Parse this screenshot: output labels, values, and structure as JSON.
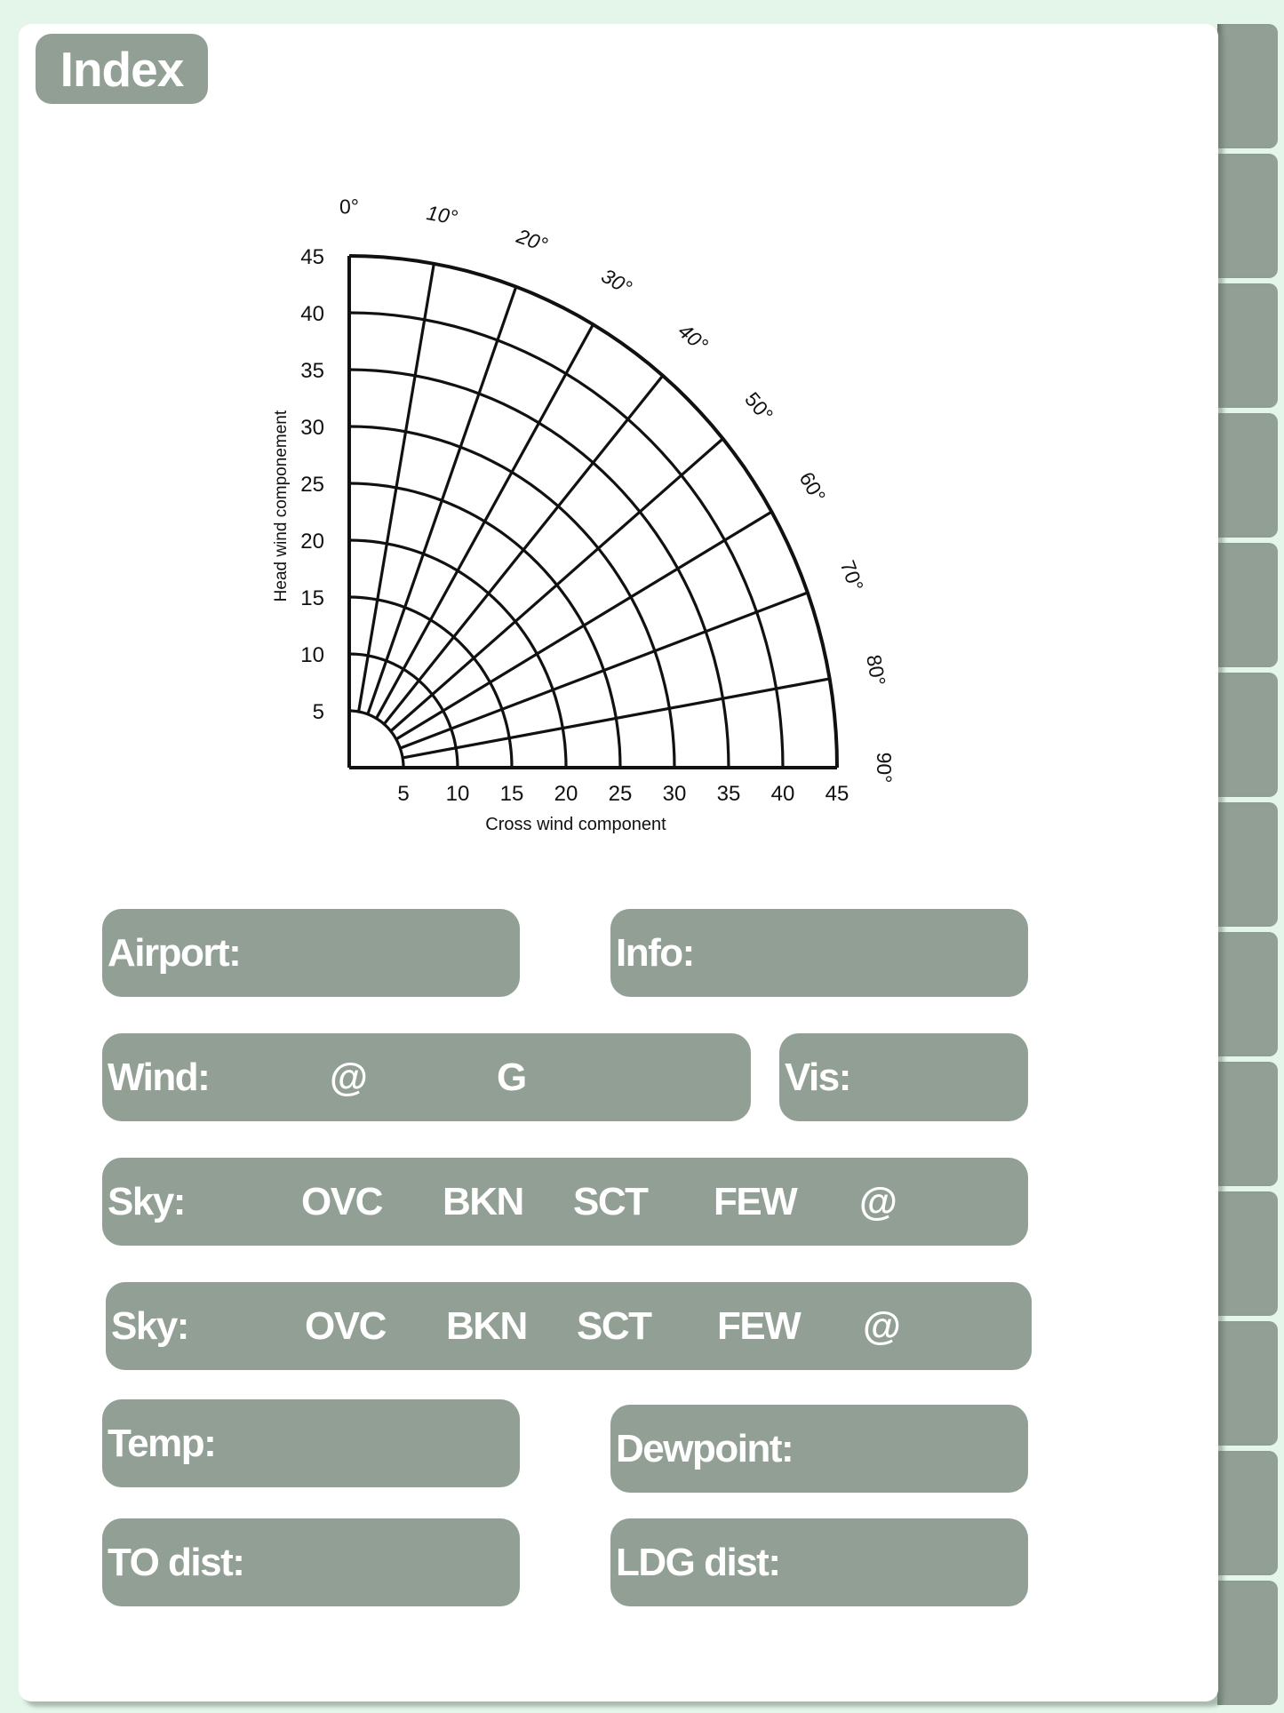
{
  "header": {
    "index_label": "Index"
  },
  "tabs_count": 13,
  "colors": {
    "accent": "#919f94",
    "background": "#e4f5ea",
    "page": "#ffffff",
    "text_on_accent": "#ffffff"
  },
  "chart_data": {
    "type": "polar-grid",
    "title": "",
    "xlabel": "Cross wind component",
    "ylabel": "Head wind componement",
    "x_ticks": [
      "5",
      "10",
      "15",
      "20",
      "25",
      "30",
      "35",
      "40",
      "45"
    ],
    "y_ticks": [
      "5",
      "10",
      "15",
      "20",
      "25",
      "30",
      "35",
      "40",
      "45"
    ],
    "angle_ticks": [
      "0°",
      "10°",
      "20°",
      "30°",
      "40°",
      "50°",
      "60°",
      "70°",
      "80°",
      "90°"
    ],
    "radii": [
      5,
      10,
      15,
      20,
      25,
      30,
      35,
      40,
      45
    ],
    "angles": [
      0,
      10,
      20,
      30,
      40,
      50,
      60,
      70,
      80,
      90
    ],
    "radial_lines_from": 5,
    "radial_lines_to": 45,
    "range": [
      0,
      45
    ]
  },
  "form": {
    "airport": {
      "label": "Airport:"
    },
    "info": {
      "label": "Info:"
    },
    "wind": {
      "label": "Wind:",
      "at": "@",
      "gust": "G"
    },
    "vis": {
      "label": "Vis:"
    },
    "sky1": {
      "label": "Sky:",
      "options": [
        "OVC",
        "BKN",
        "SCT",
        "FEW",
        "@"
      ]
    },
    "sky2": {
      "label": "Sky:",
      "options": [
        "OVC",
        "BKN",
        "SCT",
        "FEW",
        "@"
      ]
    },
    "temp": {
      "label": "Temp:"
    },
    "dewpoint": {
      "label": "Dewpoint:"
    },
    "to_dist": {
      "label": "TO dist:"
    },
    "ldg_dist": {
      "label": "LDG dist:"
    }
  }
}
